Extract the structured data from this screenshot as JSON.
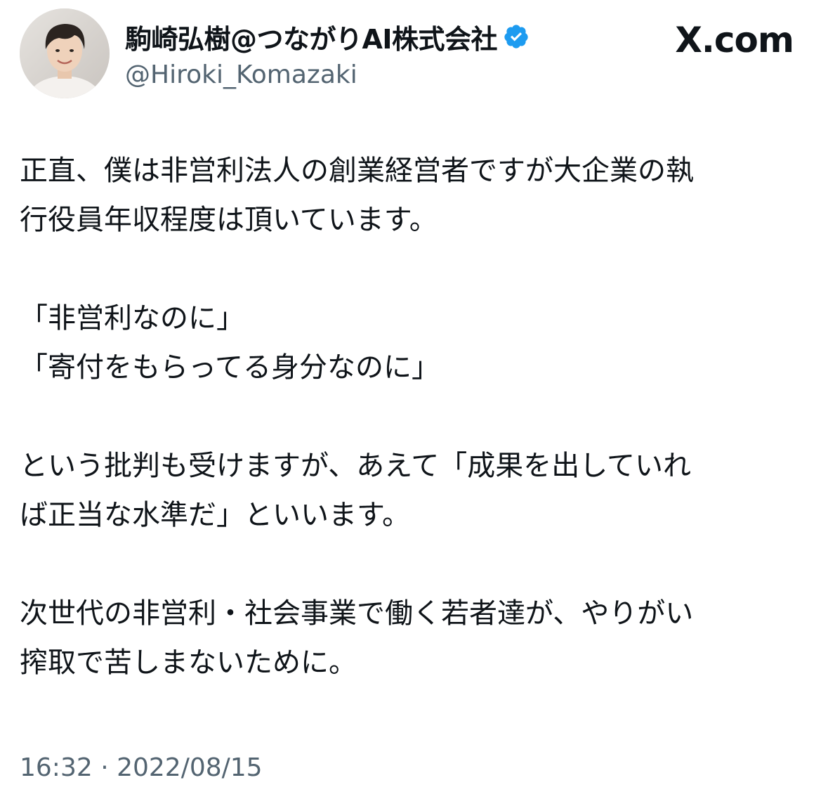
{
  "brand": {
    "logo_text": "X.com"
  },
  "author": {
    "display_name": "駒崎弘樹@つながりAI株式会社",
    "handle": "@Hiroki_Komazaki",
    "verified": true,
    "verified_color": "#1d9bf0",
    "avatar_icon": "profile-photo"
  },
  "tweet": {
    "line1": "正直、僕は非営利法人の創業経営者ですが大企業の執",
    "line2": "行役員年収程度は頂いています。",
    "line3": "「非営利なのに」",
    "line4": "「寄付をもらってる身分なのに」",
    "line5": "という批判も受けますが、あえて「成果を出していれ",
    "line6": "ば正当な水準だ」といいます。",
    "line7": "次世代の非営利・社会事業で働く若者達が、やりがい",
    "line8": "搾取で苦しまないために。",
    "timestamp": "16:32 · 2022/08/15"
  },
  "colors": {
    "text": "#0f1419",
    "secondary": "#536471",
    "background": "#ffffff"
  }
}
